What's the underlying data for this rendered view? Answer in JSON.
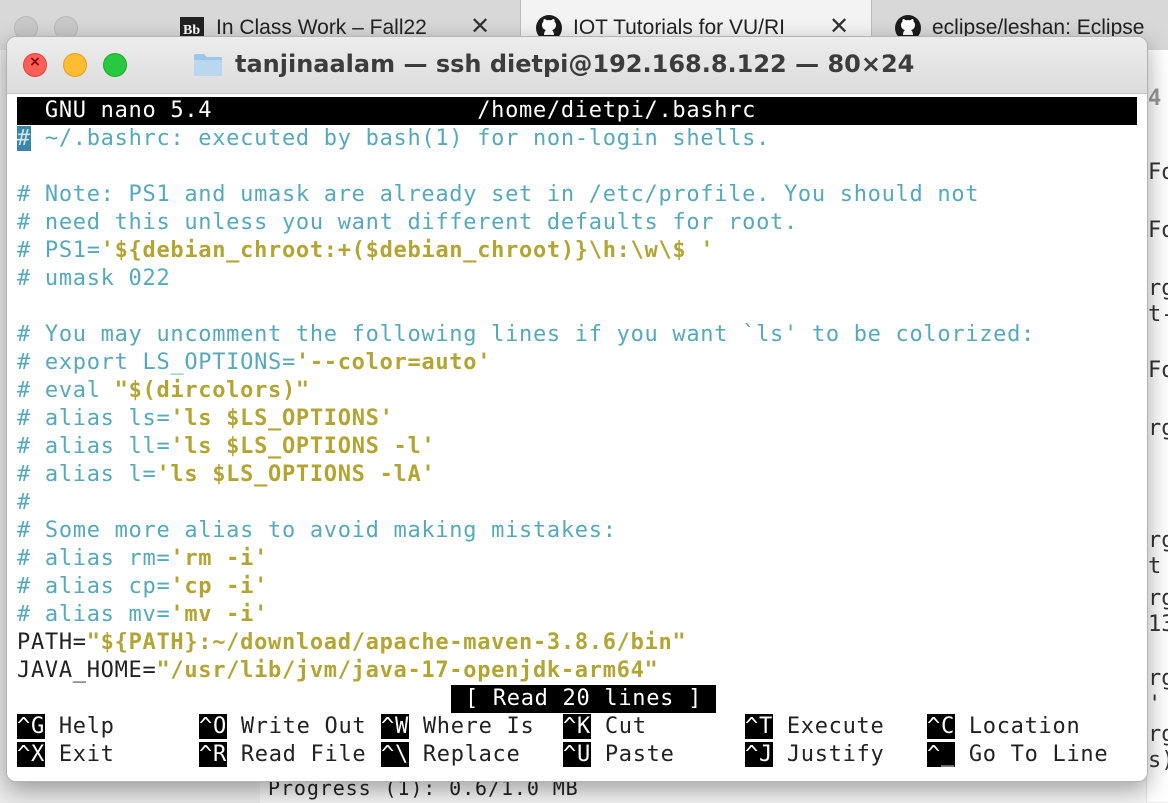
{
  "browser_tabs": [
    {
      "label": "In Class Work – Fall22",
      "icon": "blackboard-icon",
      "close": "✕"
    },
    {
      "label": "IOT Tutorials for VU/RI",
      "icon": "github-icon",
      "close": "✕"
    },
    {
      "label": "eclipse/leshan: Eclipse",
      "icon": "github-icon"
    }
  ],
  "window": {
    "title": "tanjinaalam — ssh dietpi@192.168.8.122 — 80×24"
  },
  "nano": {
    "header": "  GNU nano 5.4                   /home/dietpi/.bashrc",
    "lines": [
      [
        {
          "t": "#",
          "cls": "cursor"
        },
        {
          "t": " ~/.bashrc: executed by bash(1) for non-login shells.",
          "cls": "c"
        }
      ],
      [],
      [
        {
          "t": "# Note: PS1 and umask are already set in /etc/profile. You should not",
          "cls": "c"
        }
      ],
      [
        {
          "t": "# need this unless you want different defaults for root.",
          "cls": "c"
        }
      ],
      [
        {
          "t": "# PS1=",
          "cls": "c"
        },
        {
          "t": "'${debian_chroot:+($debian_chroot)}\\h:\\w\\$ '",
          "cls": "s"
        }
      ],
      [
        {
          "t": "# umask 022",
          "cls": "c"
        }
      ],
      [],
      [
        {
          "t": "# You may uncomment the following lines if you want `ls' to be colorized:",
          "cls": "c"
        }
      ],
      [
        {
          "t": "# export LS_OPTIONS=",
          "cls": "c"
        },
        {
          "t": "'--color=auto'",
          "cls": "s"
        }
      ],
      [
        {
          "t": "# eval ",
          "cls": "c"
        },
        {
          "t": "\"$(dircolors)\"",
          "cls": "s"
        }
      ],
      [
        {
          "t": "# alias ls=",
          "cls": "c"
        },
        {
          "t": "'ls $LS_OPTIONS'",
          "cls": "s"
        }
      ],
      [
        {
          "t": "# alias ll=",
          "cls": "c"
        },
        {
          "t": "'ls $LS_OPTIONS -l'",
          "cls": "s"
        }
      ],
      [
        {
          "t": "# alias l=",
          "cls": "c"
        },
        {
          "t": "'ls $LS_OPTIONS -lA'",
          "cls": "s"
        }
      ],
      [
        {
          "t": "#",
          "cls": "c"
        }
      ],
      [
        {
          "t": "# Some more alias to avoid making mistakes:",
          "cls": "c"
        }
      ],
      [
        {
          "t": "# alias rm=",
          "cls": "c"
        },
        {
          "t": "'rm -i'",
          "cls": "s"
        }
      ],
      [
        {
          "t": "# alias cp=",
          "cls": "c"
        },
        {
          "t": "'cp -i'",
          "cls": "s"
        }
      ],
      [
        {
          "t": "# alias mv=",
          "cls": "c"
        },
        {
          "t": "'mv -i'",
          "cls": "s"
        }
      ],
      [
        {
          "t": "PATH=",
          "cls": "k"
        },
        {
          "t": "\"${PATH}:~/download/apache-maven-3.8.6/bin\"",
          "cls": "s"
        }
      ],
      [
        {
          "t": "JAVA_HOME=",
          "cls": "k"
        },
        {
          "t": "\"/usr/lib/jvm/java-17-openjdk-arm64\"",
          "cls": "s"
        }
      ]
    ],
    "status": " [ Read 20 lines ] ",
    "shortcuts": [
      [
        {
          "key": "^G",
          "label": " Help"
        },
        {
          "key": "^O",
          "label": " Write Out"
        },
        {
          "key": "^W",
          "label": " Where Is"
        },
        {
          "key": "^K",
          "label": " Cut"
        },
        {
          "key": "^T",
          "label": " Execute"
        },
        {
          "key": "^C",
          "label": " Location"
        }
      ],
      [
        {
          "key": "^X",
          "label": " Exit"
        },
        {
          "key": "^R",
          "label": " Read File"
        },
        {
          "key": "^\\",
          "label": " Replace"
        },
        {
          "key": "^U",
          "label": " Paste"
        },
        {
          "key": "^J",
          "label": " Justify"
        },
        {
          "key": "^_",
          "label": " Go To Line"
        }
      ]
    ]
  },
  "background": {
    "right_fragments": [
      "4",
      "Fo",
      "Fo",
      "rg",
      "t-",
      "Fo",
      "rg",
      "rg",
      "t 2",
      "rg",
      "13",
      "rg",
      "' r",
      "rg",
      "s)"
    ],
    "bottom_text": "Progress (1): 0.6/1.0 MB"
  },
  "colors": {
    "comment": "#55a9bb",
    "string": "#b3a533",
    "close_red": "#fe5f57",
    "minimize_yellow": "#febc2e",
    "zoom_green": "#28c840"
  }
}
